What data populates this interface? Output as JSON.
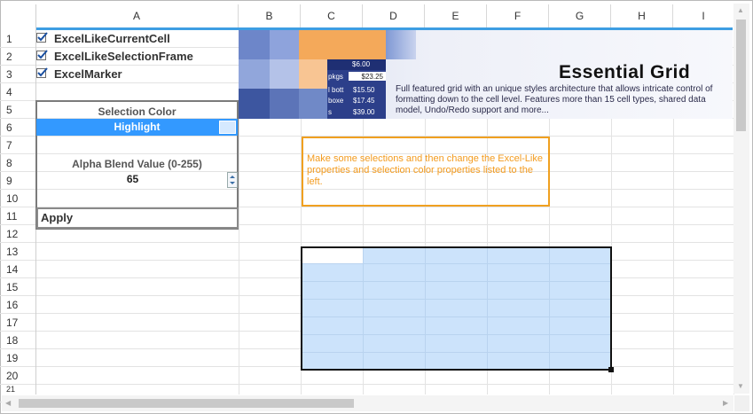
{
  "columns": [
    "A",
    "B",
    "C",
    "D",
    "E",
    "F",
    "G",
    "H",
    "I"
  ],
  "rows": [
    "1",
    "2",
    "3",
    "4",
    "5",
    "6",
    "7",
    "8",
    "9",
    "10",
    "11",
    "12",
    "13",
    "14",
    "15",
    "16",
    "17",
    "18",
    "19",
    "20",
    "21"
  ],
  "checkboxes": [
    {
      "label": "ExcelLikeCurrentCell",
      "checked": true
    },
    {
      "label": "ExcelLikeSelectionFrame",
      "checked": true
    },
    {
      "label": "ExcelMarker",
      "checked": true
    }
  ],
  "selection_color": {
    "label": "Selection Color",
    "value": "Highlight",
    "color": "#3399ff"
  },
  "alpha_blend": {
    "label": "Alpha Blend Value (0-255)",
    "value": "65"
  },
  "apply_label": "Apply",
  "note": "Make some selections and then change the Excel-Like properties and selection color properties listed to the left.",
  "banner": {
    "title": "Essential Grid",
    "description": "Full featured grid with an unique styles architecture that allows intricate control of formatting down to the cell level. Features more than 15 cell types, shared data model, Undo/Redo support and more...",
    "mini_cells": {
      "price_top": "$6.00",
      "row_labels": [
        "pkgs",
        "l bott",
        "boxe",
        "s"
      ],
      "values": [
        "$23.25",
        "$15.50",
        "$17.45",
        "$39.00"
      ]
    }
  },
  "colors": {
    "accent": "#3d9ee3",
    "selection_fill": "#cce3fb",
    "note_border": "#f0a020"
  }
}
